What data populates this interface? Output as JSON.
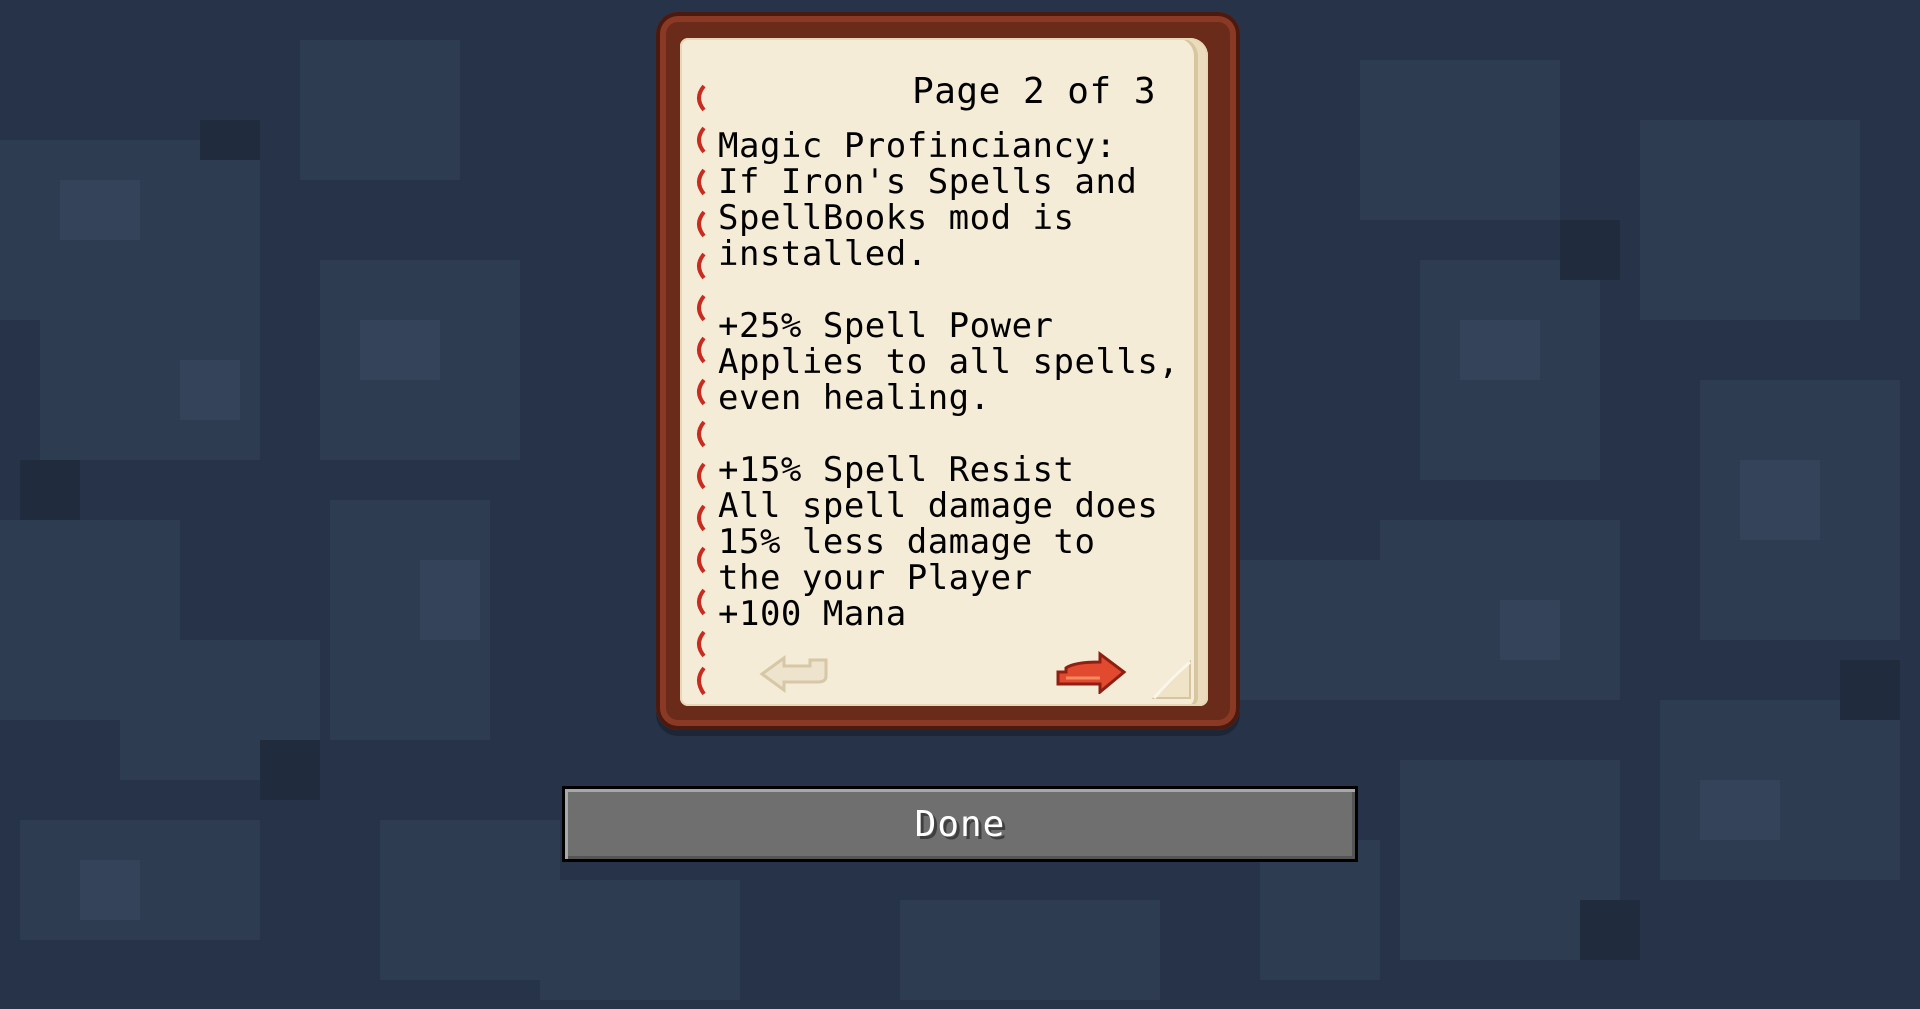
{
  "book": {
    "page_indicator": "Page 2 of 3",
    "lines": [
      "Magic Profinciancy:",
      "If Iron's Spells and",
      "SpellBooks mod is",
      "installed.",
      "",
      "+25% Spell Power",
      "Applies to all spells,",
      "even healing.",
      "",
      "+15% Spell Resist",
      "All spell damage does",
      "15% less damage to",
      "the your Player",
      "+100 Mana"
    ],
    "prev_icon": "arrow-back-icon",
    "next_icon": "arrow-forward-icon"
  },
  "done_button": {
    "label": "Done"
  },
  "colors": {
    "background": "#273348",
    "book_cover": "#6b2b1b",
    "page": "#f5ecd7",
    "next_arrow": "#d9402a",
    "prev_arrow_disabled": "#e3d6bb",
    "button": "#6f6f6f"
  }
}
